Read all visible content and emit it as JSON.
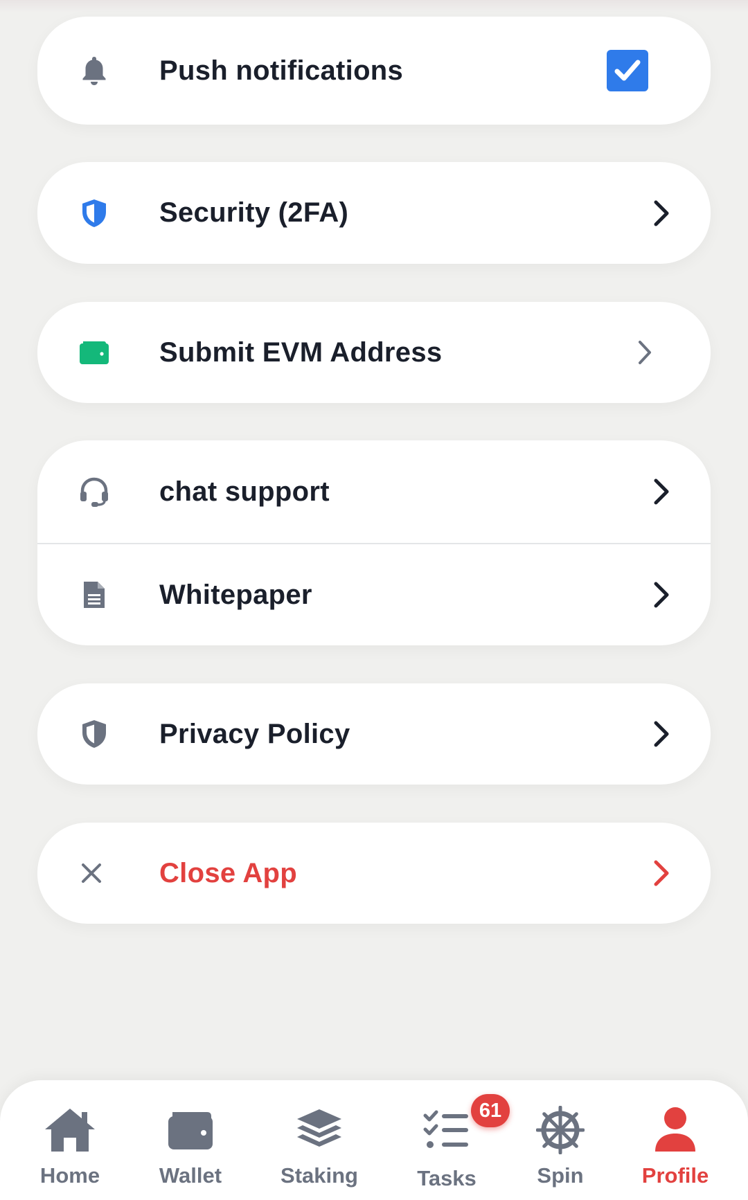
{
  "settings": {
    "push_notifications": {
      "label": "Push notifications",
      "checked": true
    },
    "security": {
      "label": "Security (2FA)"
    },
    "evm_address": {
      "label": "Submit EVM Address"
    },
    "chat_support": {
      "label": "chat support"
    },
    "whitepaper": {
      "label": "Whitepaper"
    },
    "privacy_policy": {
      "label": "Privacy Policy"
    },
    "close_app": {
      "label": "Close App"
    }
  },
  "icons": {
    "push_notifications": "bell-icon",
    "security": "shield-icon",
    "evm_address": "wallet-icon",
    "chat_support": "headset-icon",
    "whitepaper": "document-icon",
    "privacy_policy": "shield-half-icon",
    "close_app": "close-icon",
    "chevron": "chevron-right-icon",
    "checkbox": "checkmark-icon"
  },
  "bottom_nav": {
    "items": [
      {
        "label": "Home",
        "icon": "home-icon"
      },
      {
        "label": "Wallet",
        "icon": "wallet-icon"
      },
      {
        "label": "Staking",
        "icon": "layers-icon"
      },
      {
        "label": "Tasks",
        "icon": "task-list-icon",
        "badge": "61"
      },
      {
        "label": "Spin",
        "icon": "wheel-icon"
      },
      {
        "label": "Profile",
        "icon": "user-icon",
        "active": true
      }
    ]
  },
  "colors": {
    "background": "#f0f0ee",
    "card": "#ffffff",
    "text": "#1a1f2b",
    "muted_icon": "#6b7280",
    "accent_blue": "#2f7bea",
    "accent_green": "#14b87a",
    "danger": "#e2413f"
  }
}
